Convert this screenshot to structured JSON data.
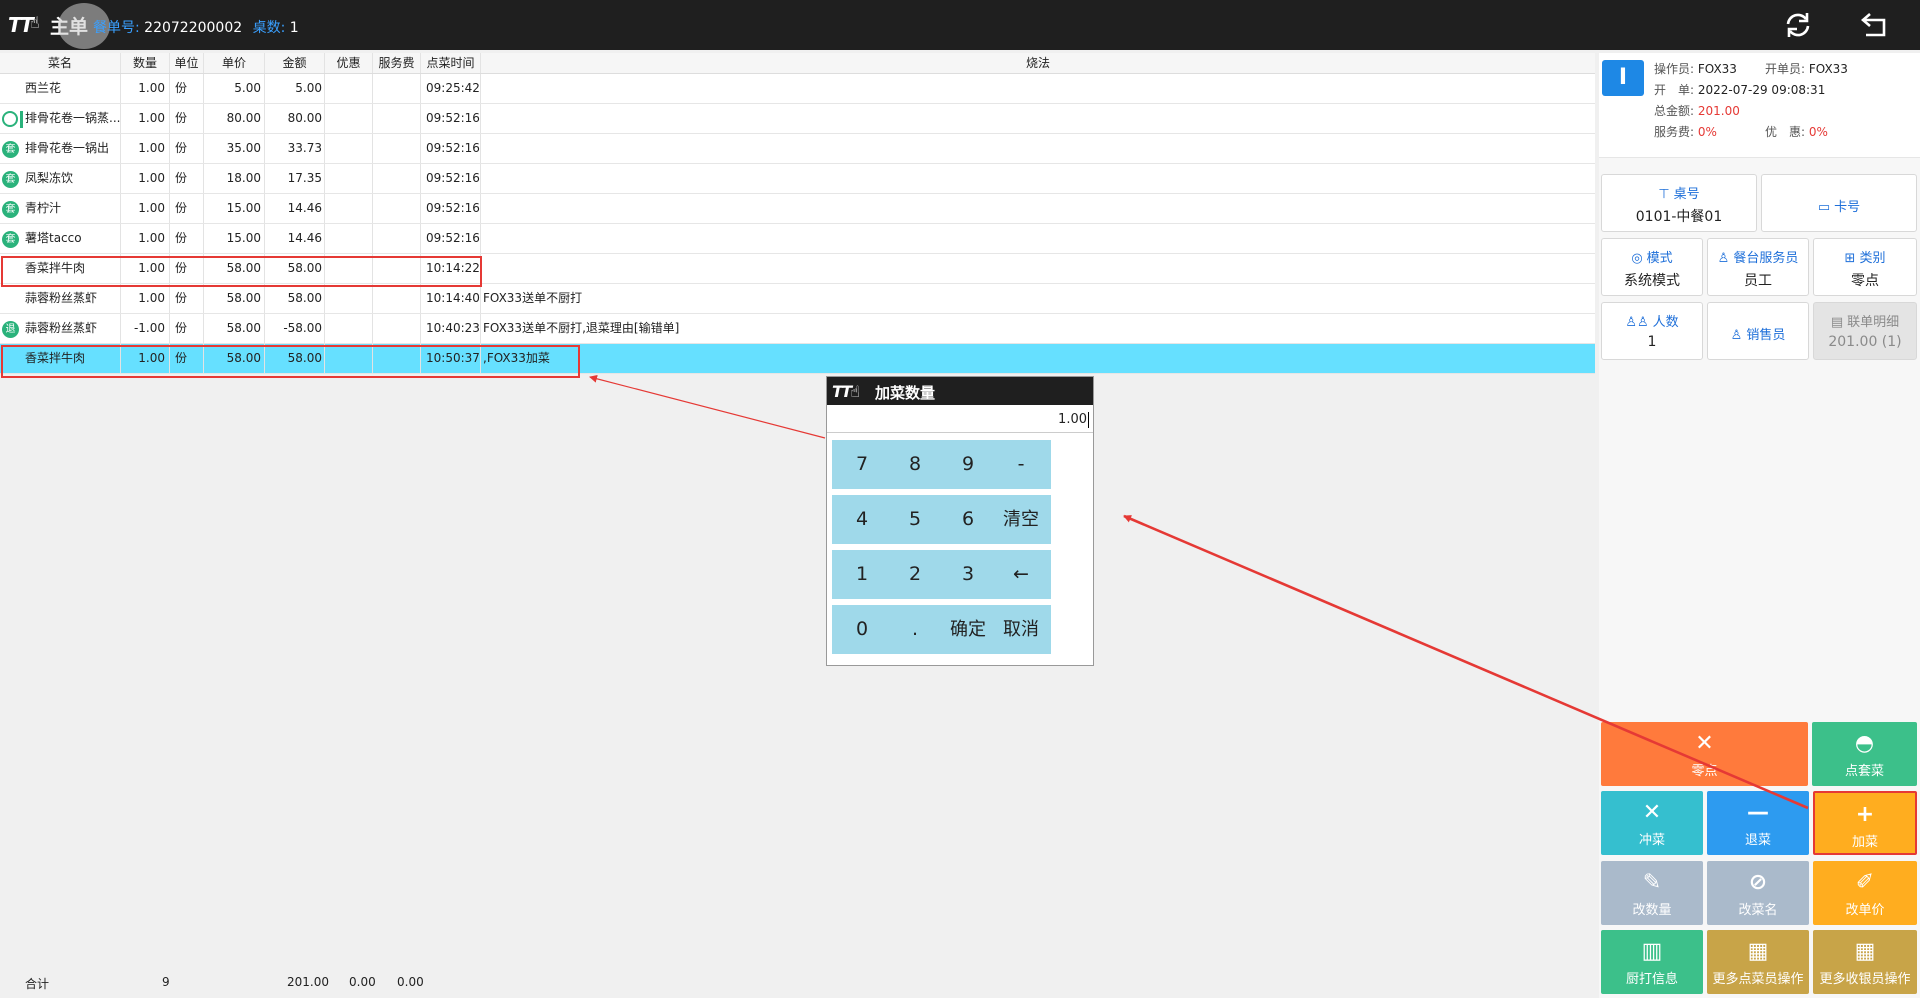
{
  "topbar": {
    "title": "主单",
    "order_no_label": "餐单号:",
    "order_no": "22072200002",
    "table_count_label": "桌数:",
    "table_count": "1"
  },
  "table": {
    "headers": [
      "菜名",
      "数量",
      "单位",
      "单价",
      "金额",
      "优惠",
      "服务费",
      "点菜时间",
      "烧法"
    ],
    "rows": [
      {
        "name": "西兰花",
        "qty": "1.00",
        "unit": "份",
        "price": "5.00",
        "amount": "5.00",
        "discount": "",
        "service": "",
        "time": "09:25:42",
        "method": "",
        "icon": ""
      },
      {
        "name": "排骨花卷一锅蒸...",
        "qty": "1.00",
        "unit": "份",
        "price": "80.00",
        "amount": "80.00",
        "discount": "",
        "service": "",
        "time": "09:52:16",
        "method": "",
        "icon": "ring"
      },
      {
        "name": "排骨花卷一锅出",
        "qty": "1.00",
        "unit": "份",
        "price": "35.00",
        "amount": "33.73",
        "discount": "",
        "service": "",
        "time": "09:52:16",
        "method": "",
        "icon": "套"
      },
      {
        "name": "凤梨冻饮",
        "qty": "1.00",
        "unit": "份",
        "price": "18.00",
        "amount": "17.35",
        "discount": "",
        "service": "",
        "time": "09:52:16",
        "method": "",
        "icon": "套"
      },
      {
        "name": "青柠汁",
        "qty": "1.00",
        "unit": "份",
        "price": "15.00",
        "amount": "14.46",
        "discount": "",
        "service": "",
        "time": "09:52:16",
        "method": "",
        "icon": "套"
      },
      {
        "name": "薯塔tacco",
        "qty": "1.00",
        "unit": "份",
        "price": "15.00",
        "amount": "14.46",
        "discount": "",
        "service": "",
        "time": "09:52:16",
        "method": "",
        "icon": "套"
      },
      {
        "name": "香菜拌牛肉",
        "qty": "1.00",
        "unit": "份",
        "price": "58.00",
        "amount": "58.00",
        "discount": "",
        "service": "",
        "time": "10:14:22",
        "method": "",
        "icon": ""
      },
      {
        "name": "蒜蓉粉丝蒸虾",
        "qty": "1.00",
        "unit": "份",
        "price": "58.00",
        "amount": "58.00",
        "discount": "",
        "service": "",
        "time": "10:14:40",
        "method": "FOX33送单不厨打",
        "icon": ""
      },
      {
        "name": "蒜蓉粉丝蒸虾",
        "qty": "-1.00",
        "unit": "份",
        "price": "58.00",
        "amount": "-58.00",
        "discount": "",
        "service": "",
        "time": "10:40:23",
        "method": "FOX33送单不厨打,退菜理由[输错单]",
        "icon": "退"
      },
      {
        "name": "香菜拌牛肉",
        "qty": "1.00",
        "unit": "份",
        "price": "58.00",
        "amount": "58.00",
        "discount": "",
        "service": "",
        "time": "10:50:37",
        "method": ",FOX33加菜",
        "icon": ""
      }
    ],
    "selected_row": 9
  },
  "totals": {
    "label": "合计",
    "qty": "9",
    "amount": "201.00",
    "discount": "0.00",
    "service": "0.00"
  },
  "info": {
    "badge": "I",
    "operator_label": "操作员:",
    "operator": "FOX33",
    "opener_label": "开单员:",
    "opener": "FOX33",
    "open_time_label": "开　单:",
    "open_time": "2022-07-29 09:08:31",
    "total_label": "总金额:",
    "total": "201.00",
    "service_label": "服务费:",
    "service": "0%",
    "discount_label": "优　惠:",
    "discount": "0%"
  },
  "tiles": {
    "table_no": {
      "label": "桌号",
      "value": "0101-中餐01"
    },
    "card_no": {
      "label": "卡号"
    },
    "mode": {
      "label": "模式",
      "value": "系统模式"
    },
    "waiter": {
      "label": "餐台服务员",
      "value": "员工"
    },
    "category": {
      "label": "类别",
      "value": "零点"
    },
    "guests": {
      "label": "人数",
      "value": "1"
    },
    "salesperson": {
      "label": "销售员"
    },
    "joint_bill": {
      "label": "联单明细",
      "value": "201.00 (1)"
    }
  },
  "actions": {
    "a_la_carte": "零点",
    "set_meal": "点套菜",
    "void": "冲菜",
    "return": "退菜",
    "add": "加菜",
    "change_qty": "改数量",
    "change_name": "改菜名",
    "change_price": "改单价",
    "kitchen_print": "厨打信息",
    "more_order": "更多点菜员操作",
    "more_cashier": "更多收银员操作"
  },
  "colors": {
    "orange": "#ff7a3c",
    "green": "#3cc08a",
    "teal": "#35bfcf",
    "blue": "#2d9bf0",
    "amber": "#ffad1f",
    "gray": "#aabacb",
    "olive": "#c8a448",
    "selected_row": "#66e0ff",
    "highlight_red": "#e53935"
  },
  "numpad": {
    "title": "加菜数量",
    "value": "1.00",
    "keys": [
      "7",
      "8",
      "9",
      "-",
      "4",
      "5",
      "6",
      "清空",
      "1",
      "2",
      "3",
      "←",
      "0",
      ".",
      "确定",
      "取消"
    ]
  }
}
